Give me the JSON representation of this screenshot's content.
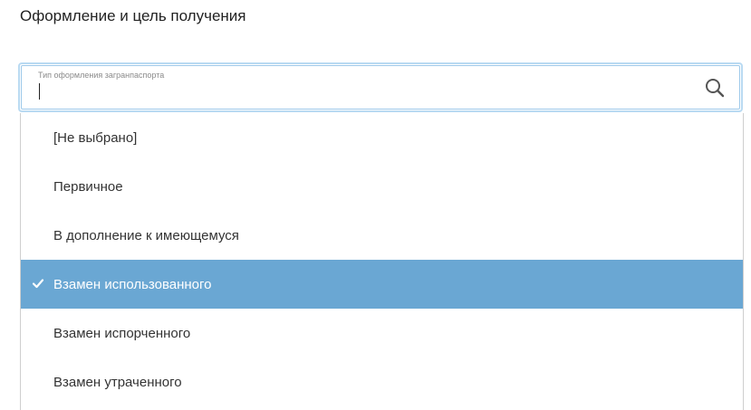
{
  "section": {
    "title": "Оформление и цель получения"
  },
  "combo": {
    "label": "Тип оформления загранпаспорта",
    "value": "",
    "icon": "search-icon"
  },
  "dropdown": {
    "options": [
      {
        "label": "[Не выбрано]",
        "selected": false
      },
      {
        "label": "Первичное",
        "selected": false
      },
      {
        "label": "В дополнение к имеющемуся",
        "selected": false
      },
      {
        "label": "Взамен использованного",
        "selected": true
      },
      {
        "label": "Взамен испорченного",
        "selected": false
      },
      {
        "label": "Взамен утраченного",
        "selected": false
      }
    ],
    "selected_icon": "check-icon"
  },
  "colors": {
    "selected_bg": "#6aa7d3",
    "focus_border": "#9ec9ea"
  }
}
